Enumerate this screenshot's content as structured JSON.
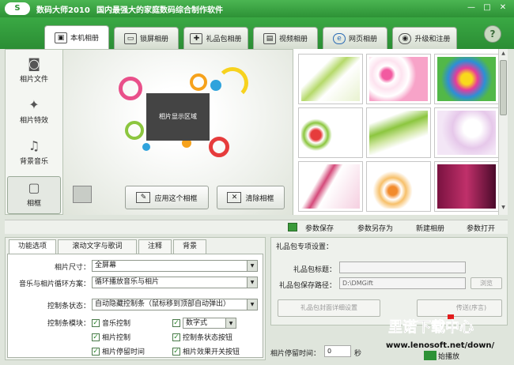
{
  "app": {
    "logo": "S",
    "title": "数码大师2010",
    "subtitle": "国内最强大的家庭数码综合制作软件",
    "min": "—",
    "max": "□",
    "close": "✕"
  },
  "tabs": [
    {
      "label": "本机相册",
      "icon": "photo-icon"
    },
    {
      "label": "锁屏相册",
      "icon": "monitor-icon"
    },
    {
      "label": "礼品包相册",
      "icon": "gift-icon"
    },
    {
      "label": "视频相册",
      "icon": "film-icon"
    },
    {
      "label": "网页相册",
      "icon": "ie-icon"
    },
    {
      "label": "升级和注册",
      "icon": "globe-icon"
    }
  ],
  "help": "?",
  "left_nav": [
    {
      "label": "相片文件",
      "icon": "camera-icon"
    },
    {
      "label": "相片特效",
      "icon": "effects-icon"
    },
    {
      "label": "背景音乐",
      "icon": "music-icon"
    },
    {
      "label": "相框",
      "icon": "frame-icon"
    }
  ],
  "preview": {
    "display_label": "相片显示区域",
    "apply_label": "应用这个相框",
    "clear_label": "清除相框"
  },
  "param_bar": {
    "save": "参数保存",
    "save_as": "参数另存为",
    "new_album": "新建相册",
    "open": "参数打开"
  },
  "settings_tabs": [
    "功能选项",
    "滚动文字与歌词",
    "注释",
    "背景"
  ],
  "settings": {
    "size_label": "相片尺寸：",
    "size_value": "全屏幕",
    "loop_label": "音乐与相片循环方案：",
    "loop_value": "循环播放音乐与相片",
    "ctrl_label": "控制条状态：",
    "ctrl_value": "自动隐藏控制条（鼠标移到顶部自动弹出）",
    "module_label": "控制条模块：",
    "checks": [
      "音乐控制",
      "相片控制",
      "相片停留时间",
      "数字式",
      "控制条状态按钮",
      "相片效果开关按钮"
    ]
  },
  "gift": {
    "title": "礼品包专项设置：",
    "title_label": "礼品包标题：",
    "path_label": "礼品包保存路径：",
    "path_value": "D:\\DMGift",
    "browse": "浏览",
    "cover_btn": "礼品包封面详细设置",
    "send_btn": "传送(序言)"
  },
  "stay": {
    "label": "相片停留时间：",
    "value": "0",
    "unit": "秒"
  },
  "watermark": {
    "line1": "里诺下载中心",
    "line2": "www.lenosoft.net/down/",
    "play": "始播放"
  },
  "colors": {
    "brand": "#2d9236",
    "accent": "#3aa944"
  }
}
